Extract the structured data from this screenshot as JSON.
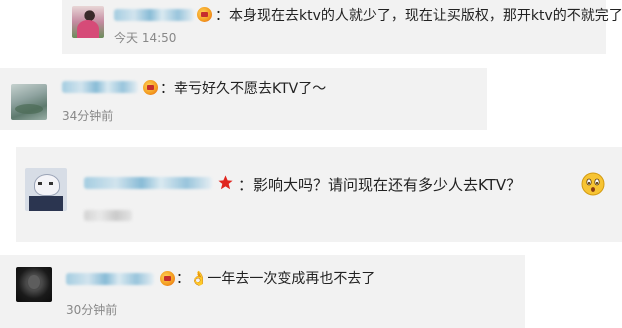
{
  "comments": [
    {
      "text": "：本身现在去ktv的人就少了，现在让买版权，那开ktv的不就完了",
      "time": "今天 14:50",
      "badge": "vip-icon",
      "avatar": "avatar-flower"
    },
    {
      "text": "：幸亏好久不愿去KTV了～",
      "time": "34分钟前",
      "badge": "vip-icon",
      "avatar": "avatar-landscape"
    },
    {
      "text": "：影响大吗？请问现在还有多少人去KTV？",
      "time": "",
      "badge": "star-icon",
      "avatar": "avatar-anime",
      "trailing_emoji": "surprised-face-icon"
    },
    {
      "text": "：👌一年去一次变成再也不去了",
      "time": "30分钟前",
      "badge": "vip-icon",
      "avatar": "avatar-dark"
    }
  ],
  "colors": {
    "card_bg": "#f2f2f2",
    "text": "#222222",
    "time": "#888888",
    "name_blur": "#8fc0da"
  }
}
